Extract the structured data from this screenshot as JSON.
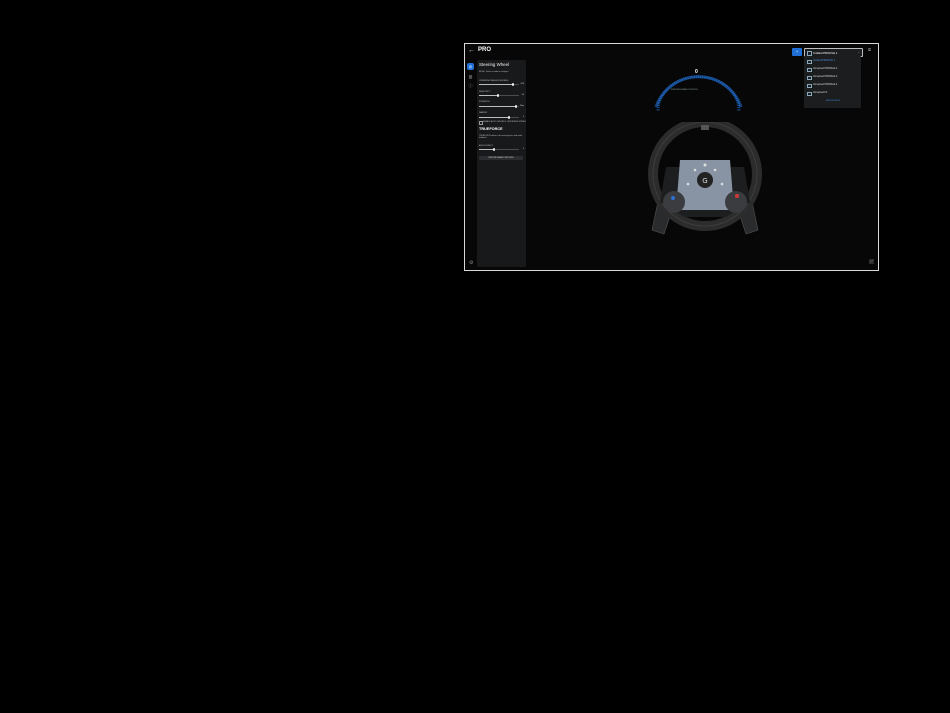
{
  "header": {
    "back_icon": "back-arrow-icon",
    "device_name": "PRO"
  },
  "rail": [
    "gear-wheel-icon",
    "pedals-icon",
    "info-icon"
  ],
  "panel": {
    "title": "Steering Wheel",
    "mode_label": "MODE",
    "mode_desc": "Select a mode to configure",
    "sliders": [
      {
        "label": "OPERATING RANGE (DEGREES)",
        "value": "900",
        "fraction": 0.82
      },
      {
        "label": "SENSITIVITY",
        "value": "50",
        "fraction": 0.44
      },
      {
        "label": "STRENGTH",
        "value": "Max",
        "fraction": 0.9
      },
      {
        "label": "DAMPER",
        "value": "0",
        "fraction": 0.72
      }
    ],
    "checkbox_label": "ENABLE AUTO-CENTER & CENTERING SPRING",
    "trueforce_title": "TRUEFORCE",
    "trueforce_desc": "TRUEFORCE delivers the actual physics and audio feedback",
    "trueforce_slider": {
      "label": "AUDIO EFFECT",
      "value": "0",
      "fraction": 0.36
    },
    "reset_label": "RESTORE DEFAULT SETTINGS",
    "settings_icon": "settings-icon"
  },
  "gauge": {
    "value": "0",
    "subtitle": "STEERING WHEEL POSITION"
  },
  "profile": {
    "selected": "Untitled PROFILE 1",
    "items": [
      "Untitled PROFILE 1",
      "Unnamed PROFILE 2",
      "Unnamed PROFILE 3",
      "Unnamed PROFILE 4",
      "Unnamed F1"
    ],
    "new_profile_label": "NEW PROFILE",
    "accent": "#1f6fd6"
  },
  "user_icon": "user-icon",
  "corner_icon": "expand-icon"
}
